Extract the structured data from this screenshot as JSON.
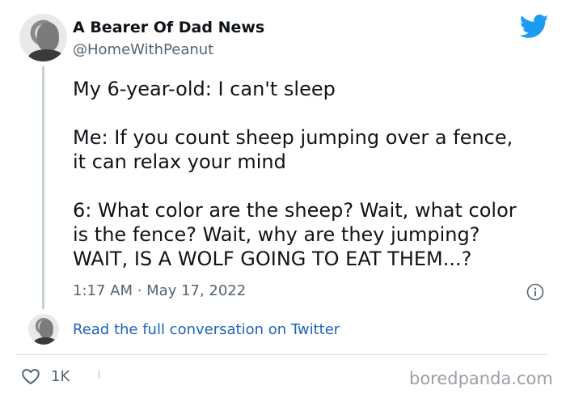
{
  "tweet": {
    "author_name": "A Bearer Of Dad News",
    "author_handle": "@HomeWithPeanut",
    "lines": [
      "My 6-year-old: I can't sleep",
      "Me: If you count sheep jumping over a fence,",
      "it can relax your mind",
      "6: What color are the sheep? Wait, what color",
      "is the fence? Wait, why are they jumping?",
      "WAIT, IS A WOLF GOING TO EAT THEM...?"
    ],
    "timestamp": "1:17 AM · May 17, 2022",
    "read_link": "Read the full conversation on Twitter",
    "likes": "1K"
  },
  "watermark": "boredpanda.com",
  "colors": {
    "twitter_blue": "#1d9bf0",
    "link_blue": "#1d64b8",
    "muted_gray": "#536471"
  },
  "icons": {
    "brand": "twitter-bird-icon",
    "info": "info-icon",
    "like": "heart-icon"
  }
}
